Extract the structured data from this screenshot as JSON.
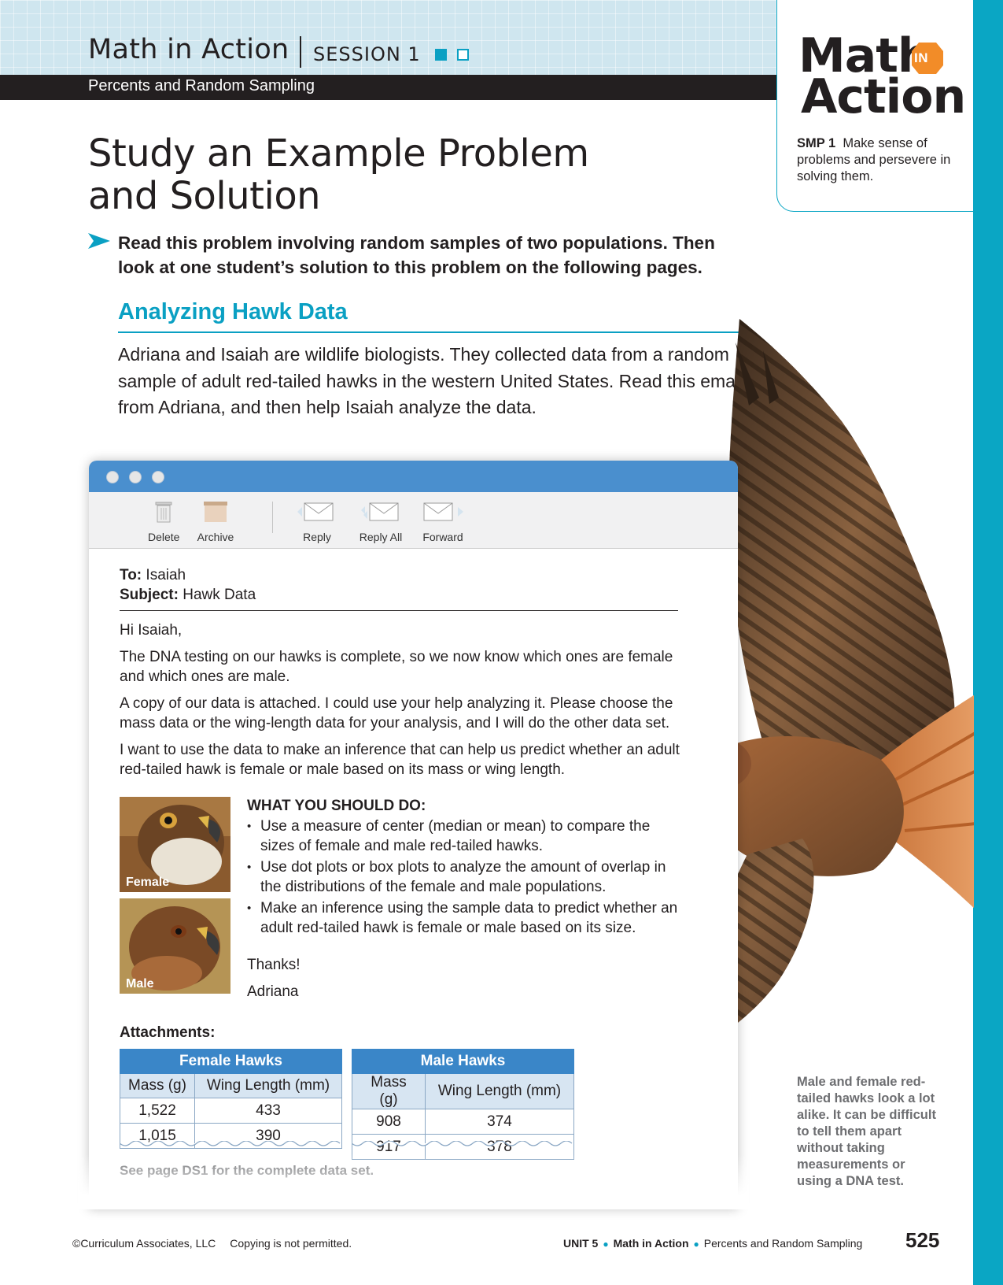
{
  "header": {
    "title": "Math in Action",
    "session": "SESSION 1",
    "subtitle": "Percents and Random Sampling"
  },
  "logo": {
    "line1": "Math",
    "badge": "IN",
    "line2": "Action",
    "accent_color": "#f28c28"
  },
  "smp": {
    "code": "SMP 1",
    "text": "Make sense of problems and persevere in solving them."
  },
  "page_title_line1": "Study an Example Problem",
  "page_title_line2": "and Solution",
  "instruction": "Read this problem involving random samples of two populations. Then look at one student’s solution to this problem on the following pages.",
  "section_title": "Analyzing Hawk Data",
  "intro": "Adriana and Isaiah are wildlife biologists. They collected data from a random sample of adult red-tailed hawks in the western United States. Read this email from Adriana, and then help Isaiah analyze the data.",
  "email": {
    "toolbar": {
      "delete": "Delete",
      "archive": "Archive",
      "reply": "Reply",
      "reply_all": "Reply All",
      "forward": "Forward"
    },
    "to_label": "To:",
    "to": "Isaiah",
    "subject_label": "Subject:",
    "subject": "Hawk Data",
    "greeting": "Hi Isaiah,",
    "p1": "The DNA testing on our hawks is complete, so we now know which ones are female and which ones are male.",
    "p2": "A copy of our data is attached. I could use your help analyzing it. Please choose the mass data or the wing-length data for your analysis, and I will do the other data set.",
    "p3": "I want to use the data to make an inference that can help us predict whether an adult red-tailed hawk is female or male based on its mass or wing length.",
    "photo_female": "Female",
    "photo_male": "Male",
    "todo_title": "WHAT YOU SHOULD DO:",
    "todo": [
      "Use a measure of center (median or mean) to compare the sizes of female and male red-tailed hawks.",
      "Use dot plots or box plots to analyze the amount of overlap in the distributions of the female and male populations.",
      "Make an inference using the sample data to predict whether an adult red-tailed hawk is female or male based on its size."
    ],
    "thanks": "Thanks!",
    "signature": "Adriana",
    "attachments_label": "Attachments:",
    "female_table": {
      "caption": "Female Hawks",
      "headers": [
        "Mass (g)",
        "Wing Length (mm)"
      ],
      "rows": [
        [
          "1,522",
          "433"
        ],
        [
          "1,015",
          "390"
        ]
      ]
    },
    "male_table": {
      "caption": "Male Hawks",
      "headers": [
        "Mass (g)",
        "Wing Length (mm)"
      ],
      "rows": [
        [
          "908",
          "374"
        ],
        [
          "917",
          "378"
        ]
      ]
    },
    "see_page": "See page DS1 for the complete data set."
  },
  "caption": "Male and female red-tailed hawks look a lot alike. It can be difficult to tell them apart without taking measurements or using a DNA test.",
  "footer": {
    "copyright": "©Curriculum Associates, LLC",
    "copying": "Copying is not permitted.",
    "unit": "UNIT 5",
    "lesson": "Math in Action",
    "topic": "Percents and Random Sampling",
    "page_number": "525"
  },
  "colors": {
    "accent": "#0aa0c3",
    "email_titlebar": "#4a8fce",
    "table_header": "#3a86c8"
  }
}
